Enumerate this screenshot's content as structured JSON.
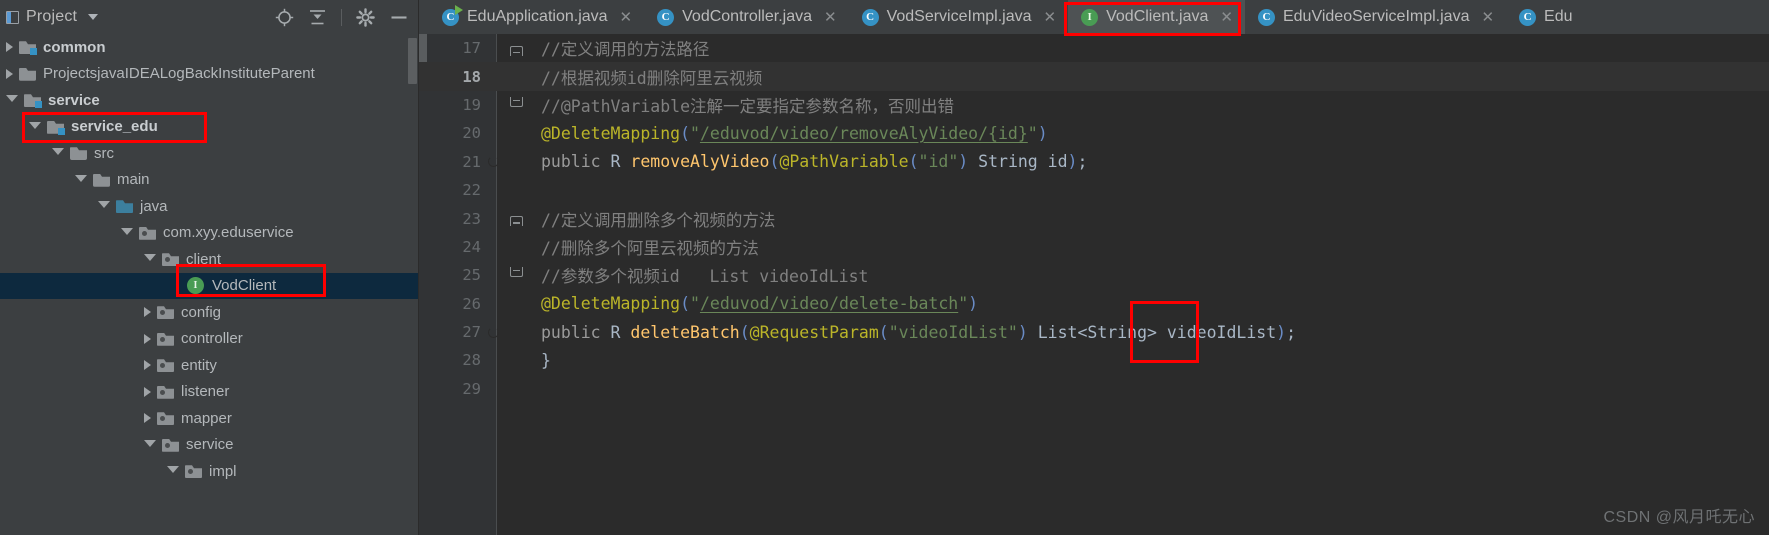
{
  "sidebar": {
    "title": "Project",
    "toolbar_icons": [
      "locate-icon",
      "collapse-all-icon",
      "settings-icon",
      "minimize-icon"
    ],
    "tree": [
      {
        "label": "common",
        "depth": 0,
        "arrow": "closed",
        "icon": "module-folder-icon",
        "bold": true,
        "selected": false
      },
      {
        "label": "ProjectsjavaIDEALogBackInstituteParent",
        "depth": 0,
        "arrow": "closed",
        "icon": "folder-icon",
        "bold": false,
        "selected": false
      },
      {
        "label": "service",
        "depth": 0,
        "arrow": "open",
        "icon": "module-folder-icon",
        "bold": true,
        "selected": false
      },
      {
        "label": "service_edu",
        "depth": 1,
        "arrow": "open",
        "icon": "module-folder-icon",
        "bold": true,
        "selected": false
      },
      {
        "label": "src",
        "depth": 2,
        "arrow": "open",
        "icon": "folder-icon",
        "bold": false,
        "selected": false
      },
      {
        "label": "main",
        "depth": 3,
        "arrow": "open",
        "icon": "folder-icon",
        "bold": false,
        "selected": false
      },
      {
        "label": "java",
        "depth": 4,
        "arrow": "open",
        "icon": "source-root-folder-icon",
        "bold": false,
        "selected": false
      },
      {
        "label": "com.xyy.eduservice",
        "depth": 5,
        "arrow": "open",
        "icon": "package-icon",
        "bold": false,
        "selected": false
      },
      {
        "label": "client",
        "depth": 6,
        "arrow": "open",
        "icon": "package-icon",
        "bold": false,
        "selected": false
      },
      {
        "label": "VodClient",
        "depth": 7,
        "arrow": "none",
        "icon": "interface-icon",
        "bold": false,
        "selected": true
      },
      {
        "label": "config",
        "depth": 6,
        "arrow": "closed",
        "icon": "package-icon",
        "bold": false,
        "selected": false
      },
      {
        "label": "controller",
        "depth": 6,
        "arrow": "closed",
        "icon": "package-icon",
        "bold": false,
        "selected": false
      },
      {
        "label": "entity",
        "depth": 6,
        "arrow": "closed",
        "icon": "package-icon",
        "bold": false,
        "selected": false
      },
      {
        "label": "listener",
        "depth": 6,
        "arrow": "closed",
        "icon": "package-icon",
        "bold": false,
        "selected": false
      },
      {
        "label": "mapper",
        "depth": 6,
        "arrow": "closed",
        "icon": "package-icon",
        "bold": false,
        "selected": false
      },
      {
        "label": "service",
        "depth": 6,
        "arrow": "open",
        "icon": "package-icon",
        "bold": false,
        "selected": false
      },
      {
        "label": "impl",
        "depth": 7,
        "arrow": "open",
        "icon": "package-icon",
        "bold": false,
        "selected": false
      }
    ]
  },
  "tabs": [
    {
      "label": "EduApplication.java",
      "badge": "runnable-class-icon",
      "active": false,
      "closable": true
    },
    {
      "label": "VodController.java",
      "badge": "class-icon",
      "active": false,
      "closable": true
    },
    {
      "label": "VodServiceImpl.java",
      "badge": "class-icon",
      "active": false,
      "closable": true
    },
    {
      "label": "VodClient.java",
      "badge": "interface-icon",
      "active": true,
      "closable": true
    },
    {
      "label": "EduVideoServiceImpl.java",
      "badge": "class-icon",
      "active": false,
      "closable": true
    },
    {
      "label": "Edu",
      "badge": "class-icon",
      "active": false,
      "closable": false
    }
  ],
  "editor": {
    "file": "VodClient.java",
    "current_line": 18,
    "lines": [
      {
        "num": "17",
        "fold": "top",
        "gutter": "",
        "text": "//定义调用的方法路径",
        "current": false
      },
      {
        "num": "18",
        "fold": "",
        "gutter": "",
        "text": "//根据视频id删除阿里云视频",
        "current": true
      },
      {
        "num": "19",
        "fold": "bottom",
        "gutter": "",
        "text": "//@PathVariable注解一定要指定参数名称，否则出错",
        "current": false
      },
      {
        "num": "20",
        "fold": "",
        "gutter": "",
        "text": "@DeleteMapping(\"/eduvod/video/removeAlyVideo/{id}\")",
        "current": false
      },
      {
        "num": "21",
        "fold": "",
        "gutter": "impl",
        "text": "public R removeAlyVideo(@PathVariable(\"id\") String id);",
        "current": false
      },
      {
        "num": "22",
        "fold": "",
        "gutter": "",
        "text": "",
        "current": false
      },
      {
        "num": "23",
        "fold": "top",
        "gutter": "",
        "text": "//定义调用删除多个视频的方法",
        "current": false
      },
      {
        "num": "24",
        "fold": "",
        "gutter": "",
        "text": "//删除多个阿里云视频的方法",
        "current": false
      },
      {
        "num": "25",
        "fold": "bottom",
        "gutter": "",
        "text": "//参数多个视频id   List videoIdList",
        "current": false
      },
      {
        "num": "26",
        "fold": "",
        "gutter": "",
        "text": "@DeleteMapping(\"/eduvod/video/delete-batch\")",
        "current": false
      },
      {
        "num": "27",
        "fold": "",
        "gutter": "impl",
        "text": "public R deleteBatch(@RequestParam(\"videoIdList\") List<String> videoIdList);",
        "current": false
      },
      {
        "num": "28",
        "fold": "",
        "gutter": "",
        "text": "}",
        "current": false
      },
      {
        "num": "29",
        "fold": "",
        "gutter": "",
        "text": "",
        "current": false
      }
    ]
  },
  "annotations": {
    "highlight_color": "#ff0000",
    "boxes": [
      {
        "name": "service-edu-node-highlight",
        "note": "service_edu tree node"
      },
      {
        "name": "vodclient-node-highlight",
        "note": "VodClient tree node"
      },
      {
        "name": "vodclient-tab-highlight",
        "note": "VodClient.java editor tab"
      },
      {
        "name": "string-generic-highlight",
        "note": "String type parameter in List<String>"
      }
    ]
  },
  "watermark": "CSDN @风月吒无心",
  "colors": {
    "panel_bg": "#3c3f41",
    "editor_bg": "#2b2b2b",
    "gutter_bg": "#313335",
    "selection_bg": "#0d293e",
    "accent_red": "#ff0000",
    "comment": "#808080",
    "annotation": "#bbb529",
    "string": "#6a8759",
    "method": "#ffc66d",
    "keyword": "#9a9a9a",
    "plain_text": "#a9b7c6"
  }
}
